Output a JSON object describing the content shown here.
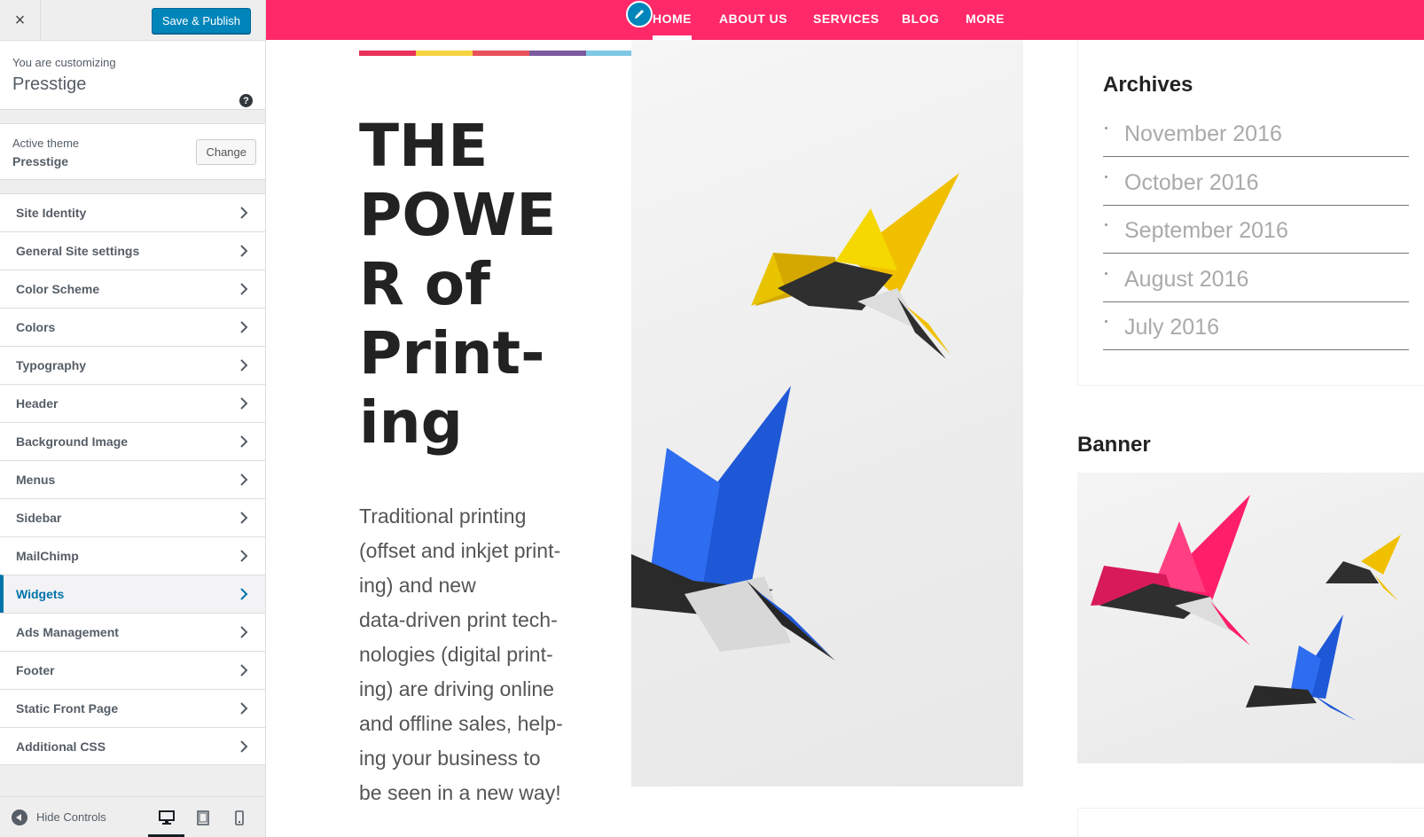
{
  "customizer": {
    "close_icon": "×",
    "publish_label": "Save & Publish",
    "customizing_label": "You are customizing",
    "site_name": "Presstige",
    "help_icon": "?",
    "active_theme_label": "Active theme",
    "active_theme_name": "Presstige",
    "change_label": "Change",
    "menu": [
      {
        "label": "Site Identity"
      },
      {
        "label": "General Site settings"
      },
      {
        "label": "Color Scheme"
      },
      {
        "label": "Colors"
      },
      {
        "label": "Typography"
      },
      {
        "label": "Header"
      },
      {
        "label": "Background Image"
      },
      {
        "label": "Menus"
      },
      {
        "label": "Sidebar"
      },
      {
        "label": "MailChimp"
      },
      {
        "label": "Widgets"
      },
      {
        "label": "Ads Management"
      },
      {
        "label": "Footer"
      },
      {
        "label": "Static Front Page"
      },
      {
        "label": "Additional CSS"
      }
    ],
    "active_menu": "Widgets",
    "hide_controls_label": "Hide Controls",
    "active_device": "desktop"
  },
  "preview": {
    "nav": [
      "HOME",
      "ABOUT US",
      "SERVICES",
      "BLOG",
      "MORE"
    ],
    "active_nav": "HOME",
    "headline_lines": [
      "THE",
      "POWE",
      "R of",
      "Print-",
      "ing"
    ],
    "intro_lines": [
      "Traditional printing",
      "(offset and inkjet print-",
      "ing) and new",
      "data-driven print tech-",
      "nologies (digital print-",
      "ing) are driving online",
      "and offline sales, help-",
      "ing your business to",
      "be seen in a new way!"
    ],
    "archives_title": "Archives",
    "archives": [
      "November 2016",
      "October 2016",
      "September 2016",
      "August 2016",
      "July 2016"
    ],
    "banner_title": "Banner"
  },
  "colors": {
    "nav_pink": "#ff2969",
    "accent_blue": "#0073aa",
    "colorbar": [
      "#e8325a",
      "#f5d442",
      "#e8505b",
      "#7b5a9e",
      "#7ec8e3"
    ]
  }
}
